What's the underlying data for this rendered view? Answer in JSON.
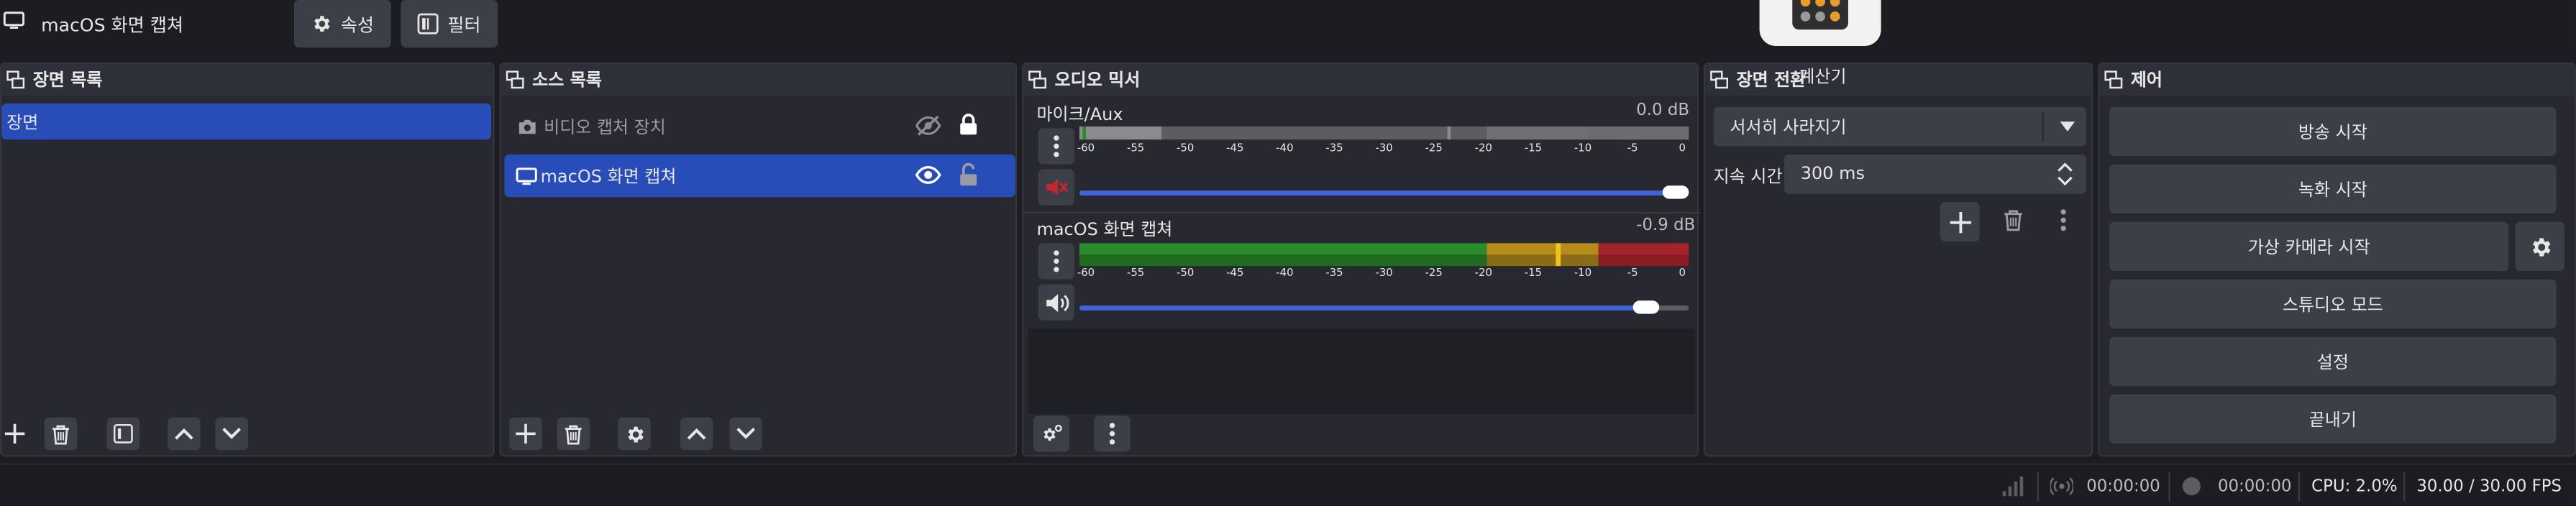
{
  "toolbar": {
    "source_name": "macOS 화면 캡쳐",
    "properties_label": "속성",
    "filters_label": "필터"
  },
  "overlay": {
    "tooltip_label": "계산기",
    "app_icon": "calculator-icon"
  },
  "scenes": {
    "title": "장면 목록",
    "items": [
      {
        "label": "장면",
        "selected": true
      }
    ]
  },
  "sources": {
    "title": "소스 목록",
    "items": [
      {
        "label": "비디오 캡처 장치",
        "visible": false,
        "locked": true,
        "icon": "camera-icon"
      },
      {
        "label": "macOS 화면 캡쳐",
        "visible": true,
        "locked": false,
        "icon": "monitor-icon",
        "selected": true
      }
    ]
  },
  "mixer": {
    "title": "오디오 믹서",
    "ticks": [
      "-60",
      "-55",
      "-50",
      "-45",
      "-40",
      "-35",
      "-30",
      "-25",
      "-20",
      "-15",
      "-10",
      "-5",
      "0"
    ],
    "channels": [
      {
        "name": "마이크/Aux",
        "level": "0.0 dB",
        "muted": true,
        "volume": 1.0
      },
      {
        "name": "macOS 화면 캡쳐",
        "level": "-0.9 dB",
        "muted": false,
        "volume": 0.95
      }
    ]
  },
  "transitions": {
    "title": "장면 전환",
    "selected": "서서히 사라지기",
    "duration_label": "지속 시간",
    "duration_value": "300 ms"
  },
  "controls": {
    "title": "제어",
    "start_streaming": "방송 시작",
    "start_recording": "녹화 시작",
    "start_virtual_camera": "가상 카메라 시작",
    "studio_mode": "스튜디오 모드",
    "settings": "설정",
    "exit": "끝내기"
  },
  "status": {
    "stream_time": "00:00:00",
    "record_time": "00:00:00",
    "cpu": "CPU: 2.0%",
    "fps": "30.00 / 30.00 FPS"
  },
  "colors": {
    "selection": "#284cb8",
    "accent_blue": "#3f64d6",
    "meter_green": "#2b8a2b",
    "meter_yellow": "#b58c1a",
    "meter_red": "#a4242c",
    "mute_red": "#c2262e"
  }
}
